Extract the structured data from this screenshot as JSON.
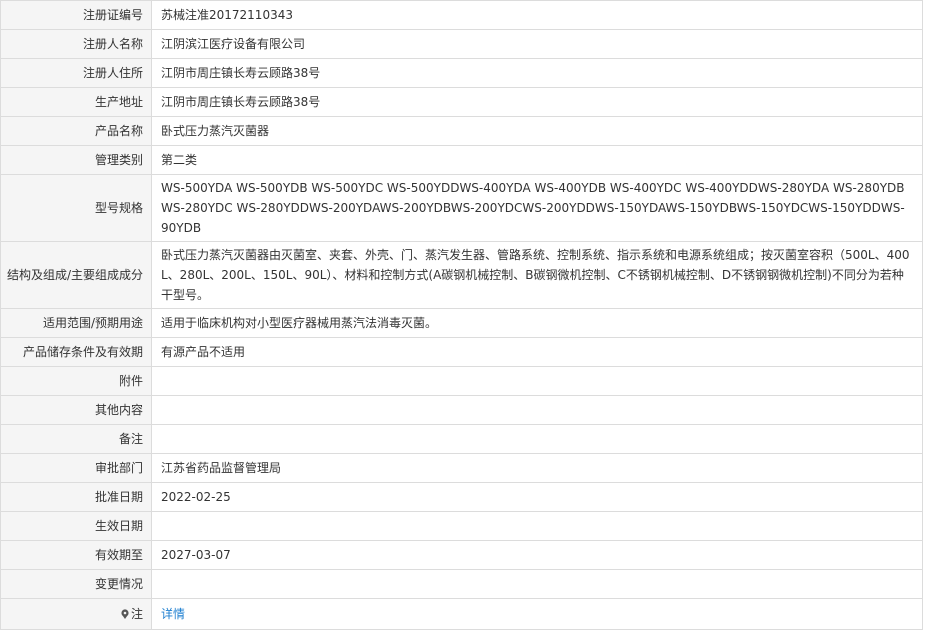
{
  "record": {
    "reg_no": {
      "label": "注册证编号",
      "value": "苏械注准20172110343"
    },
    "registrant_name": {
      "label": "注册人名称",
      "value": "江阴滨江医疗设备有限公司"
    },
    "registrant_address": {
      "label": "注册人住所",
      "value": "江阴市周庄镇长寿云顾路38号"
    },
    "production_address": {
      "label": "生产地址",
      "value": "江阴市周庄镇长寿云顾路38号"
    },
    "product_name": {
      "label": "产品名称",
      "value": "卧式压力蒸汽灭菌器"
    },
    "management_class": {
      "label": "管理类别",
      "value": "第二类"
    },
    "model_spec": {
      "label": "型号规格",
      "value": "WS-500YDA WS-500YDB WS-500YDC WS-500YDDWS-400YDA WS-400YDB WS-400YDC WS-400YDDWS-280YDA WS-280YDB WS-280YDC WS-280YDDWS-200YDAWS-200YDBWS-200YDCWS-200YDDWS-150YDAWS-150YDBWS-150YDCWS-150YDDWS-90YDB"
    },
    "structure": {
      "label": "结构及组成/主要组成成分",
      "value": "卧式压力蒸汽灭菌器由灭菌室、夹套、外壳、门、蒸汽发生器、管路系统、控制系统、指示系统和电源系统组成；按灭菌室容积（500L、400L、280L、200L、150L、90L）、材料和控制方式(A碳钢机械控制、B碳钢微机控制、C不锈钢机械控制、D不锈钢钢微机控制)不同分为若种干型号。"
    },
    "scope": {
      "label": "适用范围/预期用途",
      "value": "适用于临床机构对小型医疗器械用蒸汽法消毒灭菌。"
    },
    "storage": {
      "label": "产品储存条件及有效期",
      "value": "有源产品不适用"
    },
    "attachment": {
      "label": "附件",
      "value": ""
    },
    "other": {
      "label": "其他内容",
      "value": ""
    },
    "remarks": {
      "label": "备注",
      "value": ""
    },
    "approval_dept": {
      "label": "审批部门",
      "value": "江苏省药品监督管理局"
    },
    "approval_date": {
      "label": "批准日期",
      "value": "2022-02-25"
    },
    "effective_date": {
      "label": "生效日期",
      "value": ""
    },
    "valid_until": {
      "label": "有效期至",
      "value": "2027-03-07"
    },
    "change_status": {
      "label": "变更情况",
      "value": ""
    },
    "note": {
      "label": "注",
      "icon": "location-pin-icon",
      "link_text": "详情"
    }
  },
  "colors": {
    "label_bg": "#f5f5f5",
    "border": "#dcdcdc",
    "text": "#333333",
    "link": "#1e7fd0"
  }
}
